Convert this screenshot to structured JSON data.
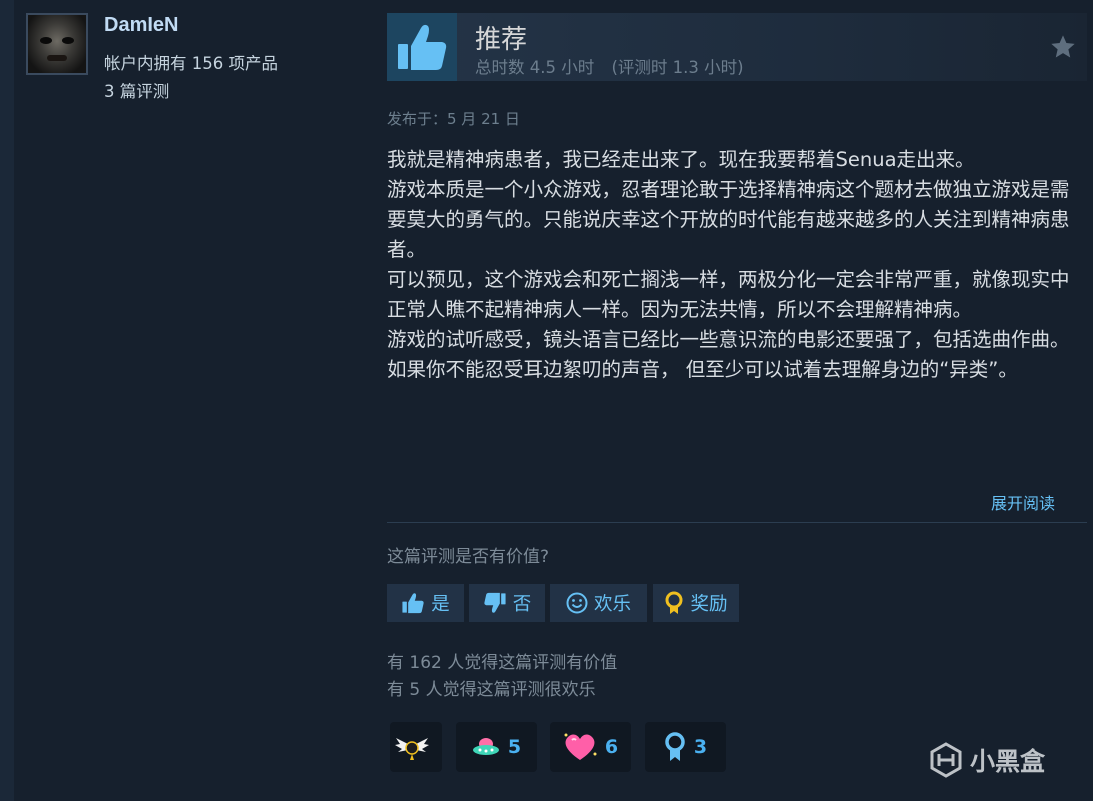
{
  "user": {
    "name": "DamIeN",
    "products": "帐户内拥有 156 项产品",
    "reviews": "3 篇评测"
  },
  "review": {
    "verdict": "推荐",
    "total_hours": "总时数 4.5 小时",
    "hours_at_review": "(评测时 1.3 小时)",
    "posted": "发布于：5 月 21 日",
    "paragraphs": [
      "我就是精神病患者，我已经走出来了。现在我要帮着Senua走出来。",
      "游戏本质是一个小众游戏，忍者理论敢于选择精神病这个题材去做独立游戏是需要莫大的勇气的。只能说庆幸这个开放的时代能有越来越多的人关注到精神病患者。",
      "可以预见，这个游戏会和死亡搁浅一样，两极分化一定会非常严重，就像现实中正常人瞧不起精神病人一样。因为无法共情，所以不会理解精神病。",
      "游戏的试听感受，镜头语言已经比一些意识流的电影还要强了，包括选曲作曲。",
      "如果你不能忍受耳边絮叨的声音， 但至少可以试着去理解身边的“异类”。"
    ],
    "expand_label": "展开阅读"
  },
  "feedback": {
    "question": "这篇评测是否有价值?",
    "yes_label": "是",
    "no_label": "否",
    "funny_label": "欢乐",
    "award_label": "奖励",
    "helpful_stat": "有 162 人觉得这篇评测有价值",
    "funny_stat": "有 5 人觉得这篇评测很欢乐"
  },
  "awards": [
    {
      "icon": "winged-award-icon",
      "count": ""
    },
    {
      "icon": "ufo-award-icon",
      "count": "5"
    },
    {
      "icon": "heart-award-icon",
      "count": "6"
    },
    {
      "icon": "ribbon-award-icon",
      "count": "3"
    }
  ],
  "watermark": "小黑盒",
  "colors": {
    "background": "#1b2838",
    "panel": "#16202d",
    "accent": "#66c0f4",
    "button": "#223246"
  }
}
